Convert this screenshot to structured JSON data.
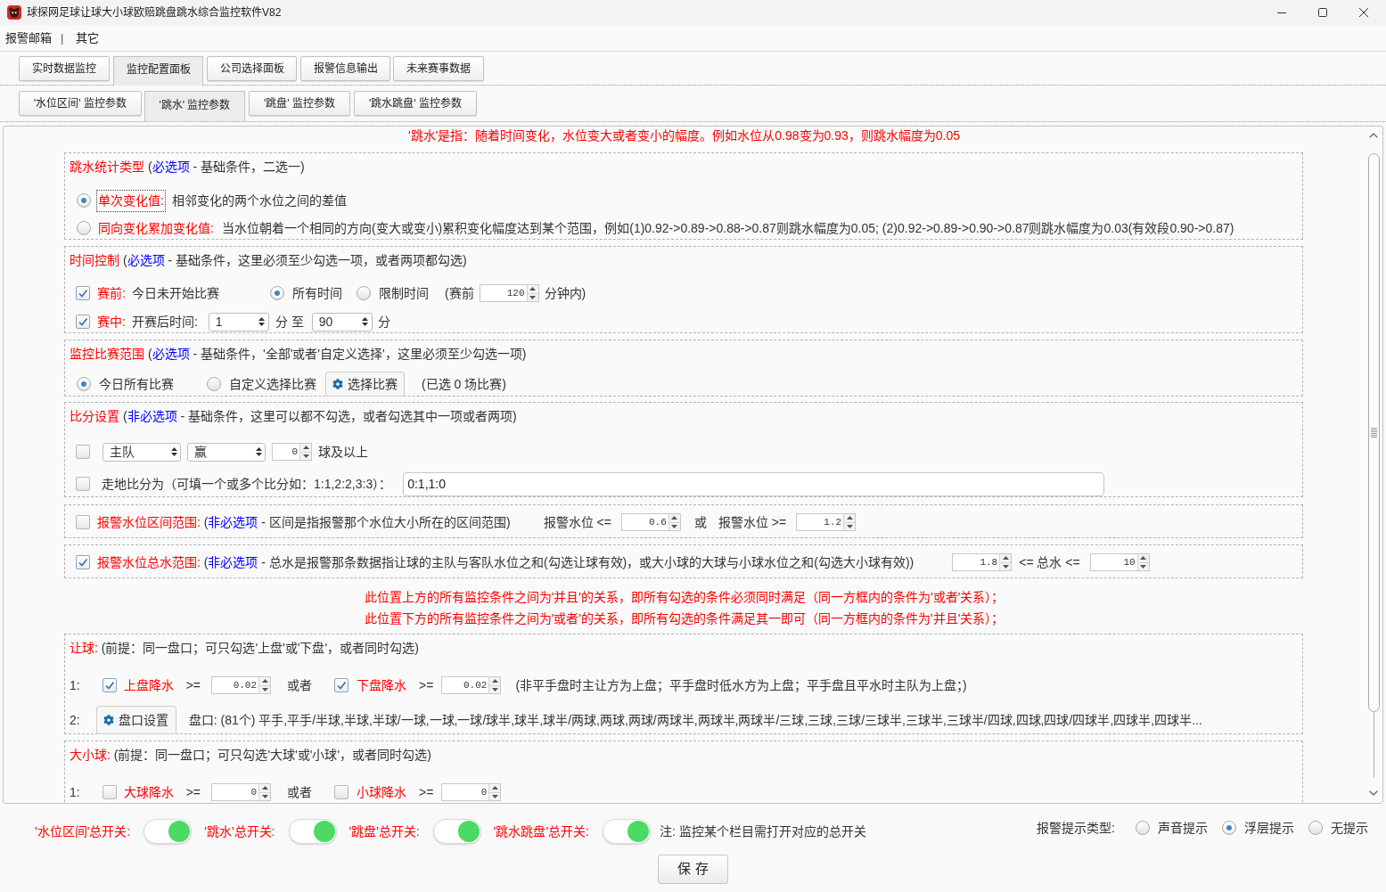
{
  "window": {
    "title": "球探网足球让球大小球欧赔跳盘跳水综合监控软件V82"
  },
  "menu": {
    "items": [
      {
        "label": "报警邮箱"
      },
      {
        "label": "其它"
      }
    ],
    "separator": "|"
  },
  "main_tabs": [
    {
      "label": "实时数据监控",
      "selected": false
    },
    {
      "label": "监控配置面板",
      "selected": true
    },
    {
      "label": "公司选择面板",
      "selected": false
    },
    {
      "label": "报警信息输出",
      "selected": false
    },
    {
      "label": "未来赛事数据",
      "selected": false
    }
  ],
  "sub_tabs": [
    {
      "label": "'水位区间' 监控参数",
      "selected": false
    },
    {
      "label": "'跳水' 监控参数",
      "selected": true
    },
    {
      "label": "'跳盘' 监控参数",
      "selected": false
    },
    {
      "label": "'跳水跳盘' 监控参数",
      "selected": false
    }
  ],
  "content": {
    "note": "'跳水'是指：随着时间变化，水位变大或者变小的幅度。例如水位从0.98变为0.93，则跳水幅度为0.05",
    "upper_sections": [
      {
        "heading": [
          {
            "kind": "title",
            "text": "跳水统计类型"
          },
          {
            "kind": "plain",
            "text": " ("
          },
          {
            "kind": "tag",
            "text": "必选项"
          },
          {
            "kind": "plain",
            "text": " - 基础条件，二选一)"
          }
        ],
        "lines": [
          {
            "controls": [
              {
                "kind": "radio",
                "selected": true
              },
              {
                "kind": "label",
                "text": "单次变化值:",
                "focused": true
              },
              {
                "kind": "text",
                "text": "相邻变化的两个水位之间的差值"
              }
            ]
          },
          {
            "controls": [
              {
                "kind": "radio",
                "selected": false
              },
              {
                "kind": "label",
                "text": "同向变化累加变化值:"
              },
              {
                "kind": "text",
                "text": "当水位朝着一个相同的方向(变大或变小)累积变化幅度达到某个范围，例如(1)0.92->0.89->0.88->0.87则跳水幅度为0.05; (2)0.92->0.89->0.90->0.87则跳水幅度为0.03(有效段0.90->0.87)"
              }
            ]
          }
        ]
      },
      {
        "heading": [
          {
            "kind": "title",
            "text": "时间控制"
          },
          {
            "kind": "plain",
            "text": " ("
          },
          {
            "kind": "tag",
            "text": "必选项"
          },
          {
            "kind": "plain",
            "text": " - 基础条件，这里必须至少勾选一项，或者两项都勾选)"
          }
        ],
        "lines": [
          {
            "controls": [
              {
                "kind": "checkbox",
                "checked": true
              },
              {
                "kind": "label",
                "text": "赛前:"
              },
              {
                "kind": "text",
                "text": "今日未开始比赛"
              },
              {
                "kind": "radio",
                "selected": true
              },
              {
                "kind": "text",
                "text": "所有时间"
              },
              {
                "kind": "radio",
                "selected": false
              },
              {
                "kind": "text",
                "text": "限制时间"
              },
              {
                "kind": "text",
                "text": "(赛前"
              },
              {
                "kind": "spinner",
                "value": "120"
              },
              {
                "kind": "text",
                "text": "分钟内)"
              }
            ]
          },
          {
            "controls": [
              {
                "kind": "checkbox",
                "checked": true
              },
              {
                "kind": "label",
                "text": "赛中:"
              },
              {
                "kind": "text",
                "text": "开赛后时间:"
              },
              {
                "kind": "counter",
                "value": "1"
              },
              {
                "kind": "text",
                "text": "分 至"
              },
              {
                "kind": "counter",
                "value": "90"
              },
              {
                "kind": "text",
                "text": "分"
              }
            ]
          }
        ]
      },
      {
        "heading": [
          {
            "kind": "title",
            "text": "监控比赛范围"
          },
          {
            "kind": "plain",
            "text": " ("
          },
          {
            "kind": "tag",
            "text": "必选项"
          },
          {
            "kind": "plain",
            "text": " - 基础条件，'全部'或者'自定义选择'，这里必须至少勾选一项)"
          }
        ],
        "lines": [
          {
            "controls": [
              {
                "kind": "radio",
                "selected": true
              },
              {
                "kind": "text",
                "text": "今日所有比赛"
              },
              {
                "kind": "radio",
                "selected": false
              },
              {
                "kind": "text",
                "text": "自定义选择比赛"
              },
              {
                "kind": "button",
                "label": "选择比赛"
              },
              {
                "kind": "text",
                "text": "(已选 0 场比赛)"
              }
            ]
          }
        ]
      },
      {
        "heading": [
          {
            "kind": "title",
            "text": "比分设置"
          },
          {
            "kind": "plain",
            "text": " ("
          },
          {
            "kind": "tag",
            "text": "非必选项"
          },
          {
            "kind": "plain",
            "text": " - 基础条件，这里可以都不勾选，或者勾选其中一项或者两项)"
          }
        ],
        "lines": [
          {
            "controls": [
              {
                "kind": "checkbox",
                "checked": false
              },
              {
                "kind": "select",
                "value": "主队"
              },
              {
                "kind": "select",
                "value": "赢"
              },
              {
                "kind": "spinner",
                "value": "0"
              },
              {
                "kind": "text",
                "text": "球及以上"
              }
            ]
          },
          {
            "controls": [
              {
                "kind": "checkbox",
                "checked": false
              },
              {
                "kind": "text",
                "text": "走地比分为（可填一个或多个比分如：1:1,2:2,3:3）："
              },
              {
                "kind": "input",
                "value": "0:1,1:0"
              }
            ]
          }
        ]
      },
      {
        "lines": [
          {
            "controls": [
              {
                "kind": "checkbox",
                "checked": false
              },
              {
                "kind": "phrase",
                "parts": [
                  {
                    "kind": "title",
                    "text": "报警水位区间范围:"
                  },
                  {
                    "kind": "plain",
                    "text": " ("
                  },
                  {
                    "kind": "tag",
                    "text": "非必选项"
                  },
                  {
                    "kind": "plain",
                    "text": " - 区间是指报警那个水位大小所在的区间范围)"
                  }
                ]
              },
              {
                "kind": "text",
                "text": "报警水位 <="
              },
              {
                "kind": "spinner",
                "value": "0.6"
              },
              {
                "kind": "text",
                "text": "或"
              },
              {
                "kind": "text",
                "text": "报警水位 >="
              },
              {
                "kind": "spinner",
                "value": "1.2"
              }
            ]
          }
        ]
      },
      {
        "lines": [
          {
            "controls": [
              {
                "kind": "checkbox",
                "checked": true
              },
              {
                "kind": "phrase",
                "parts": [
                  {
                    "kind": "title",
                    "text": "报警水位总水范围:"
                  },
                  {
                    "kind": "plain",
                    "text": " ("
                  },
                  {
                    "kind": "tag",
                    "text": "非必选项"
                  },
                  {
                    "kind": "plain",
                    "text": " - 总水是报警那条数据指让球的主队与客队水位之和(勾选让球有效)，或大小球的大球与小球水位之和(勾选大小球有效))"
                  }
                ]
              },
              {
                "kind": "spinner",
                "value": "1.8"
              },
              {
                "kind": "text",
                "text": "<= 总水 <="
              },
              {
                "kind": "spinner",
                "value": "10"
              }
            ]
          }
        ]
      }
    ],
    "logic_notes": [
      "此位置上方的所有监控条件之间为'并且'的关系，即所有勾选的条件必须同时满足（同一方框内的条件为'或者'关系）；",
      "此位置下方的所有监控条件之间为'或者'的关系，即所有勾选的条件满足其一即可（同一方框内的条件为'并且'关系）；"
    ],
    "lower_sections": [
      {
        "heading": [
          {
            "kind": "title",
            "text": "让球:"
          },
          {
            "kind": "plain",
            "text": " (前提：同一盘口；可只勾选'上盘'或'下盘'，或者同时勾选)"
          }
        ],
        "lines": [
          {
            "controls": [
              {
                "kind": "text",
                "text": "1:"
              },
              {
                "kind": "checkbox",
                "checked": true
              },
              {
                "kind": "label",
                "text": "上盘降水"
              },
              {
                "kind": "text",
                "text": ">="
              },
              {
                "kind": "spinner",
                "value": "0.02"
              },
              {
                "kind": "text",
                "text": "或者"
              },
              {
                "kind": "checkbox",
                "checked": true
              },
              {
                "kind": "label",
                "text": "下盘降水"
              },
              {
                "kind": "text",
                "text": ">="
              },
              {
                "kind": "spinner",
                "value": "0.02"
              },
              {
                "kind": "text",
                "text": "(非平手盘时主让方为上盘；平手盘时低水方为上盘；平手盘且平水时主队为上盘；)"
              }
            ]
          },
          {
            "controls": [
              {
                "kind": "text",
                "text": "2:"
              },
              {
                "kind": "button",
                "label": "盘口设置"
              },
              {
                "kind": "text",
                "text": "盘口: (81个) 平手,平手/半球,半球,半球/一球,一球,一球/球半,球半,球半/两球,两球,两球/两球半,两球半,两球半/三球,三球,三球/三球半,三球半,三球半/四球,四球,四球/四球半,四球半,四球半..."
              }
            ]
          }
        ]
      },
      {
        "heading": [
          {
            "kind": "title",
            "text": "大小球:"
          },
          {
            "kind": "plain",
            "text": " (前提：同一盘口；可只勾选'大球'或'小球'，或者同时勾选)"
          }
        ],
        "lines": [
          {
            "controls": [
              {
                "kind": "text",
                "text": "1:"
              },
              {
                "kind": "checkbox",
                "checked": false
              },
              {
                "kind": "label",
                "text": "大球降水"
              },
              {
                "kind": "text",
                "text": ">="
              },
              {
                "kind": "spinner",
                "value": "0"
              },
              {
                "kind": "text",
                "text": "或者"
              },
              {
                "kind": "checkbox",
                "checked": false
              },
              {
                "kind": "label",
                "text": "小球降水"
              },
              {
                "kind": "text",
                "text": ">="
              },
              {
                "kind": "spinner",
                "value": "0"
              }
            ]
          }
        ]
      }
    ]
  },
  "footer": {
    "switches": [
      {
        "label": "'水位区间'总开关:",
        "on": true
      },
      {
        "label": "'跳水'总开关:",
        "on": true
      },
      {
        "label": "'跳盘'总开关:",
        "on": true
      },
      {
        "label": "'跳水跳盘'总开关:",
        "on": true
      }
    ],
    "switch_note": "注: 监控某个栏目需打开对应的总开关",
    "alert_type": {
      "label": "报警提示类型:",
      "options": [
        {
          "label": "声音提示",
          "selected": false
        },
        {
          "label": "浮层提示",
          "selected": true
        },
        {
          "label": "无提示",
          "selected": false
        }
      ]
    },
    "save_button": "保 存"
  }
}
